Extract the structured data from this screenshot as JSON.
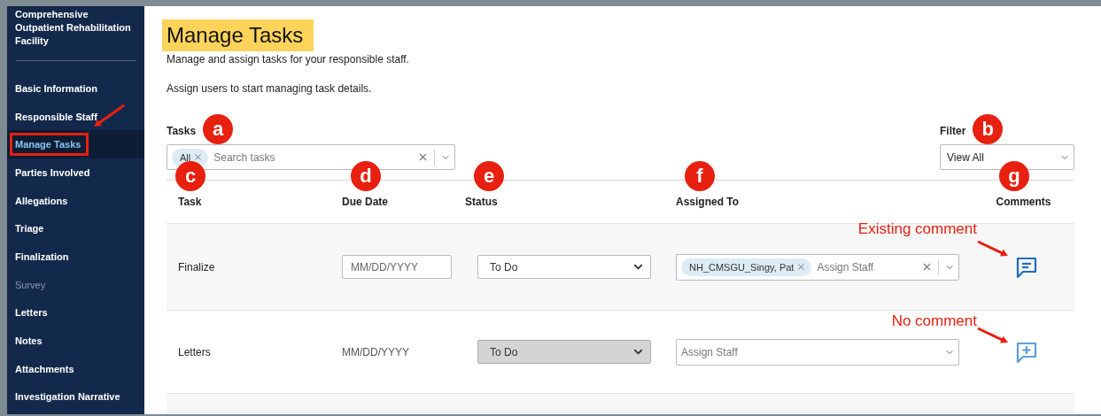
{
  "sidebar": {
    "heading": "Comprehensive Outpatient Rehabilitation Facility",
    "items": [
      {
        "label": "Basic Information",
        "selected": false,
        "disabled": false,
        "annotated": false
      },
      {
        "label": "Responsible Staff",
        "selected": false,
        "disabled": false,
        "annotated": false
      },
      {
        "label": "Manage Tasks",
        "selected": true,
        "disabled": false,
        "annotated": true
      },
      {
        "label": "Parties Involved",
        "selected": false,
        "disabled": false,
        "annotated": false
      },
      {
        "label": "Allegations",
        "selected": false,
        "disabled": false,
        "annotated": false
      },
      {
        "label": "Triage",
        "selected": false,
        "disabled": false,
        "annotated": false
      },
      {
        "label": "Finalization",
        "selected": false,
        "disabled": false,
        "annotated": false
      },
      {
        "label": "Survey",
        "selected": false,
        "disabled": true,
        "annotated": false
      },
      {
        "label": "Letters",
        "selected": false,
        "disabled": false,
        "annotated": false
      },
      {
        "label": "Notes",
        "selected": false,
        "disabled": false,
        "annotated": false
      },
      {
        "label": "Attachments",
        "selected": false,
        "disabled": false,
        "annotated": false
      },
      {
        "label": "Investigation Narrative",
        "selected": false,
        "disabled": false,
        "annotated": false
      }
    ]
  },
  "page": {
    "title": "Manage Tasks",
    "title_highlighted": true,
    "description": "Manage and assign tasks for your responsible staff.",
    "hint": "Assign users to start managing task details."
  },
  "tasks_filter": {
    "label": "Tasks",
    "marker": "a",
    "chips": [
      "All"
    ],
    "placeholder": "Search tasks"
  },
  "view_filter": {
    "label": "Filter",
    "marker": "b",
    "value": "View All"
  },
  "table": {
    "columns": [
      {
        "label": "Task",
        "marker": "c"
      },
      {
        "label": "Due Date",
        "marker": "d"
      },
      {
        "label": "Status",
        "marker": "e"
      },
      {
        "label": "Assigned To",
        "marker": "f"
      },
      {
        "label": "Comments",
        "marker": "g"
      }
    ],
    "rows": [
      {
        "task": "Finalize",
        "due_date": {
          "kind": "input",
          "placeholder": "MM/DD/YYYY"
        },
        "status": {
          "value": "To Do",
          "disabled": false
        },
        "assigned": {
          "chips": [
            "NH_CMSGU_Singy, Pat"
          ],
          "placeholder": "Assign Staff"
        },
        "has_comment": true,
        "annotation": "Existing comment"
      },
      {
        "task": "Letters",
        "due_date": {
          "kind": "text",
          "text": "MM/DD/YYYY"
        },
        "status": {
          "value": "To Do",
          "disabled": true
        },
        "assigned": {
          "placeholder": "Assign Staff"
        },
        "has_comment": false,
        "annotation": "No comment"
      }
    ]
  }
}
